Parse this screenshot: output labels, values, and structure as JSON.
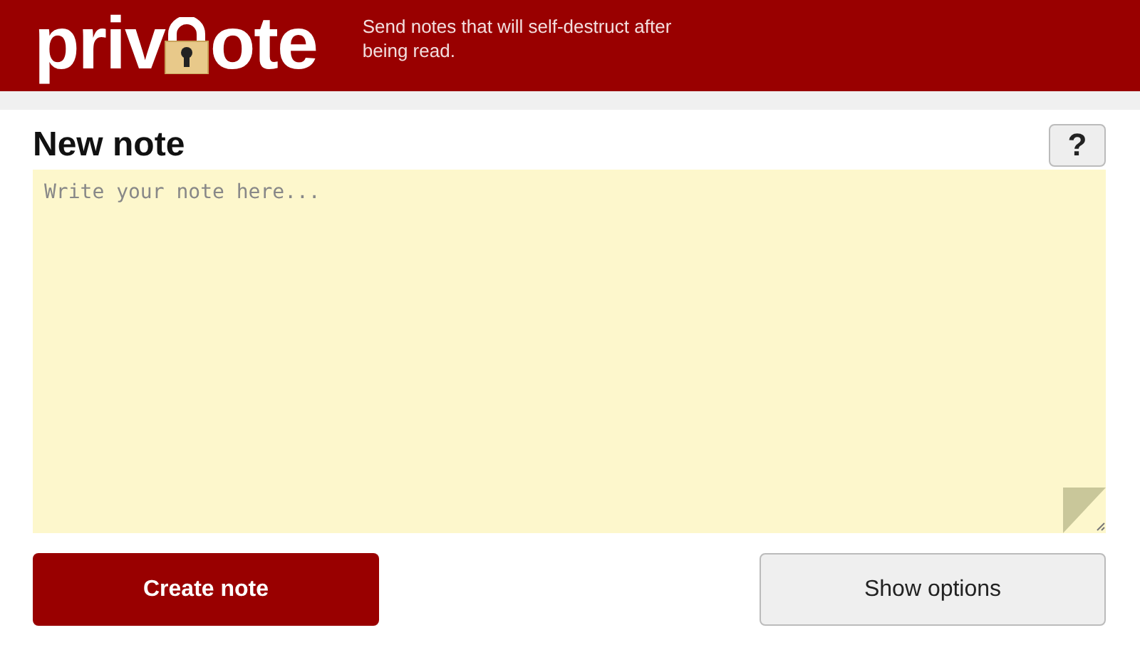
{
  "header": {
    "logo": {
      "left": "priv",
      "right": "ote"
    },
    "tagline": "Send notes that will self-destruct after being read."
  },
  "note": {
    "title": "New note",
    "help_button": "?",
    "placeholder": "Write your note here..."
  },
  "buttons": [
    {
      "label": "Create note",
      "kind": "primary"
    },
    {
      "label": "Show options",
      "kind": "secondary"
    }
  ]
}
